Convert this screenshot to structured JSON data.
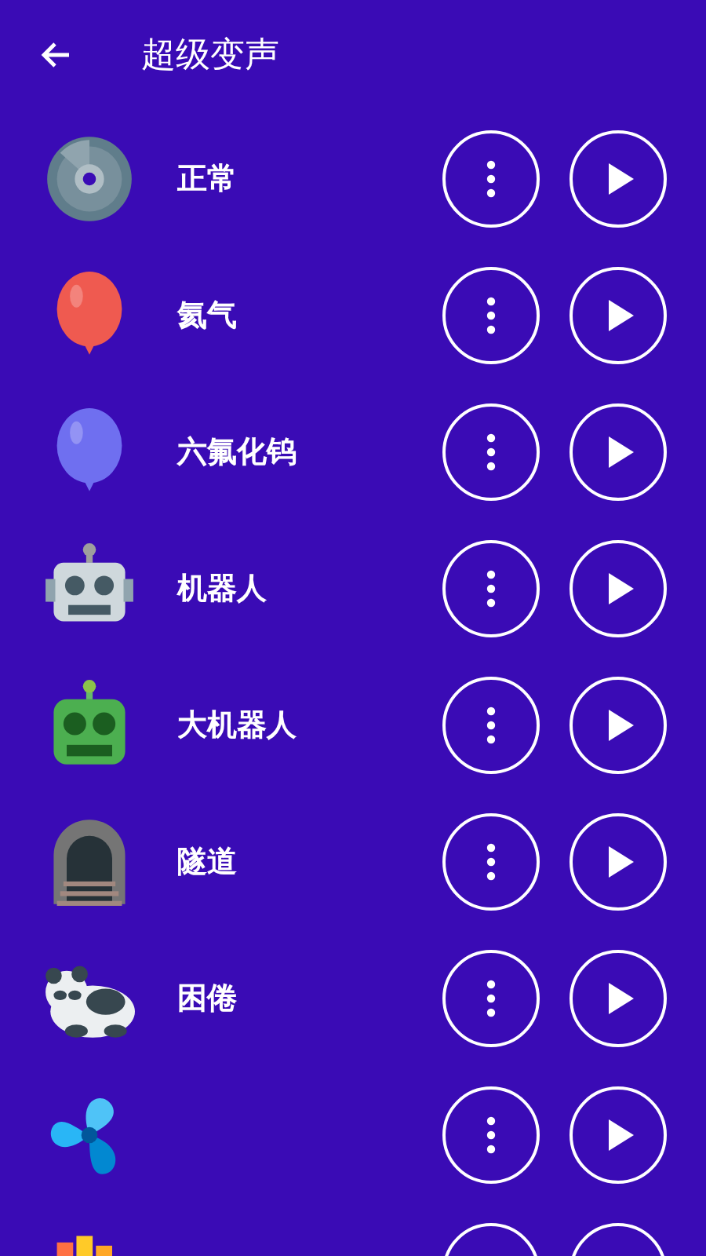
{
  "header": {
    "title": "超级变声"
  },
  "effects": [
    {
      "kind": "disc",
      "label": "正常"
    },
    {
      "kind": "balloon",
      "color": "#ef5a50",
      "label": "氦气"
    },
    {
      "kind": "balloon",
      "color": "#6f6ff0",
      "label": "六氟化钨"
    },
    {
      "kind": "robot",
      "label": "机器人"
    },
    {
      "kind": "greenrobot",
      "label": "大机器人"
    },
    {
      "kind": "tunnel",
      "label": "隧道"
    },
    {
      "kind": "panda",
      "label": "困倦"
    },
    {
      "kind": "fan"
    },
    {
      "kind": "books"
    }
  ]
}
